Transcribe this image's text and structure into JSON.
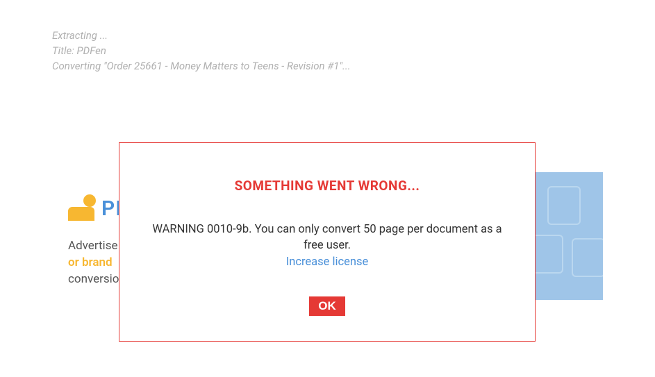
{
  "status": {
    "line1": "Extracting ...",
    "line2": "Title: PDFen",
    "line3": "Converting \"Order 25661 - Money Matters to Teens - Revision #1\"..."
  },
  "ad": {
    "logo_text": "PI",
    "text_part1": "Advertise",
    "highlight": "or brand ",
    "text_part2": "conversio"
  },
  "modal": {
    "title": "SOMETHING WENT WRONG...",
    "warning": "WARNING 0010-9b. You can only convert 50 page per document as a free user.",
    "link_text": "Increase license",
    "ok_label": "OK"
  }
}
